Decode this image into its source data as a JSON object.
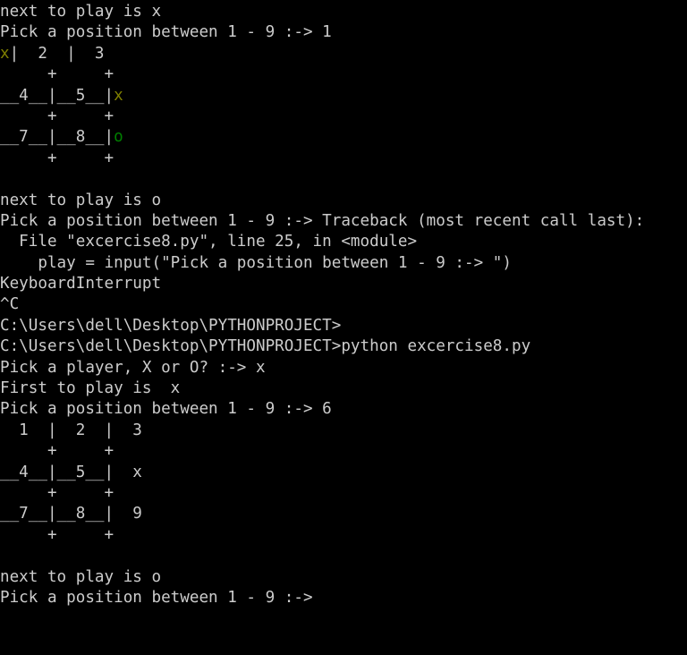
{
  "terminal": {
    "title": "Command Prompt",
    "colors": {
      "background": "#000000",
      "foreground": "#cccccc",
      "x_marker": "#808000",
      "o_marker": "#008000"
    },
    "cursor": {
      "column": 34,
      "row": 28
    },
    "lines": [
      {
        "id": "l1",
        "text": "next to play is x"
      },
      {
        "id": "l2",
        "text": "Pick a position between 1 - 9 :-> 1"
      },
      {
        "id": "l3",
        "segments": [
          {
            "text": "x",
            "color": "x"
          },
          {
            "text": "|  2  |  3",
            "color": "fg"
          }
        ]
      },
      {
        "id": "l4",
        "text": "     +     +"
      },
      {
        "id": "l5",
        "segments": [
          {
            "text": "__4__|__5__|",
            "color": "fg"
          },
          {
            "text": "x",
            "color": "x"
          }
        ]
      },
      {
        "id": "l6",
        "text": "     +     +"
      },
      {
        "id": "l7",
        "segments": [
          {
            "text": "__7__|__8__|",
            "color": "fg"
          },
          {
            "text": "o",
            "color": "o"
          }
        ]
      },
      {
        "id": "l8",
        "text": "     +     +"
      },
      {
        "id": "l9",
        "text": ""
      },
      {
        "id": "l10",
        "text": "next to play is o"
      },
      {
        "id": "l11",
        "text": "Pick a position between 1 - 9 :-> Traceback (most recent call last):"
      },
      {
        "id": "l12",
        "text": "  File \"excercise8.py\", line 25, in <module>"
      },
      {
        "id": "l13",
        "text": "    play = input(\"Pick a position between 1 - 9 :-> \")"
      },
      {
        "id": "l14",
        "text": "KeyboardInterrupt"
      },
      {
        "id": "l15",
        "text": "^C"
      },
      {
        "id": "l16",
        "text": "C:\\Users\\dell\\Desktop\\PYTHONPROJECT>"
      },
      {
        "id": "l17",
        "text": "C:\\Users\\dell\\Desktop\\PYTHONPROJECT>python excercise8.py"
      },
      {
        "id": "l18",
        "text": "Pick a player, X or O? :-> x"
      },
      {
        "id": "l19",
        "text": "First to play is  x"
      },
      {
        "id": "l20",
        "text": "Pick a position between 1 - 9 :-> 6"
      },
      {
        "id": "l21",
        "text": "  1  |  2  |  3"
      },
      {
        "id": "l22",
        "text": "     +     +"
      },
      {
        "id": "l23",
        "text": "__4__|__5__|  x"
      },
      {
        "id": "l24",
        "text": "     +     +"
      },
      {
        "id": "l25",
        "text": "__7__|__8__|  9"
      },
      {
        "id": "l26",
        "text": "     +     +"
      },
      {
        "id": "l27",
        "text": ""
      },
      {
        "id": "l28",
        "text": "next to play is o"
      },
      {
        "id": "l29",
        "text": "Pick a position between 1 - 9 :-> "
      }
    ]
  },
  "session": {
    "script_name": "excercise8.py",
    "working_directory": "C:\\Users\\dell\\Desktop\\PYTHONPROJECT",
    "command": "python excercise8.py",
    "exception": "KeyboardInterrupt",
    "interrupt_signal": "^C",
    "error_line_number": "25",
    "error_scope": "<module>",
    "player_choice": "x",
    "first_player": "x",
    "moves": [
      "1",
      "6"
    ],
    "prompt_player": "Pick a player, X or O? :-> ",
    "prompt_position": "Pick a position between 1 - 9 :-> "
  }
}
